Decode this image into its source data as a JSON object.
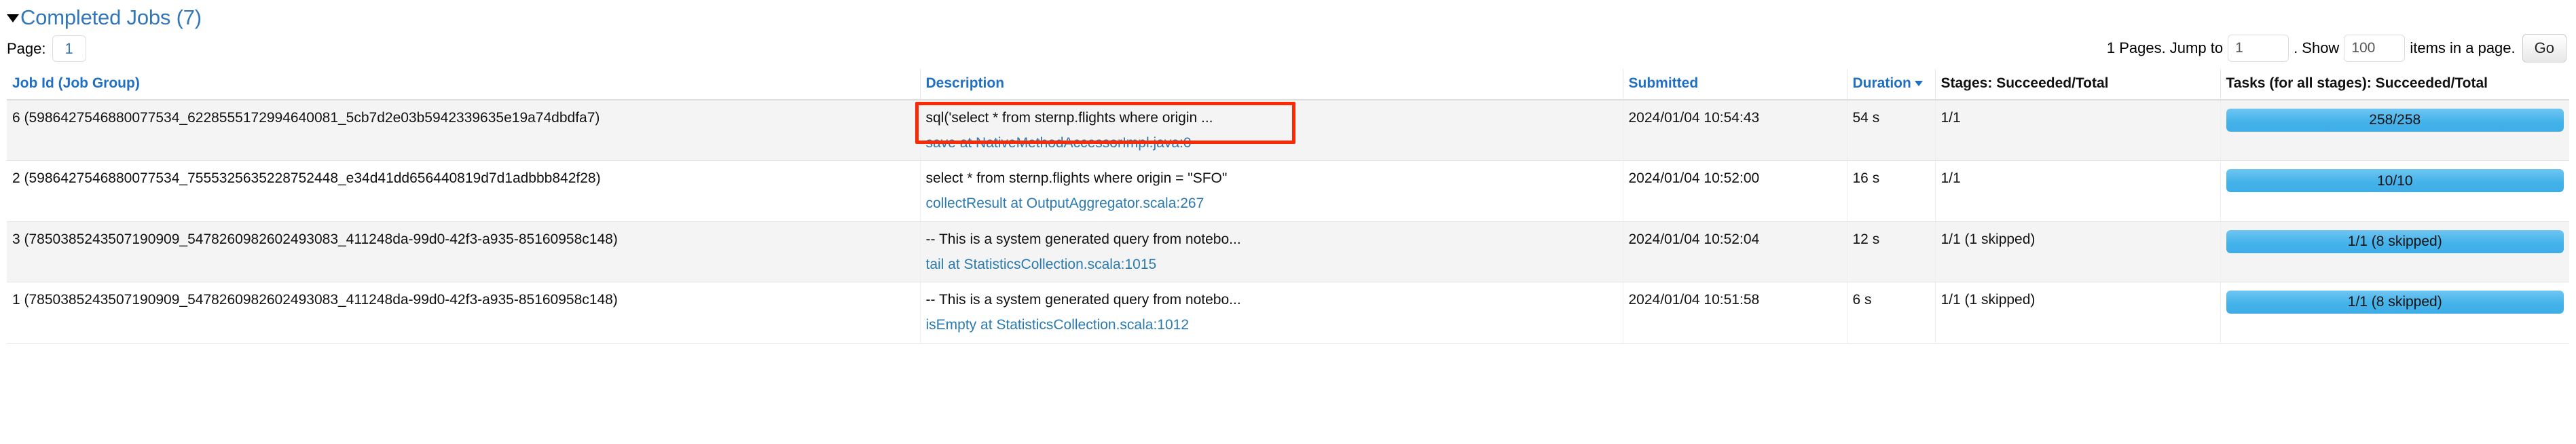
{
  "section": {
    "title": "Completed Jobs (7)",
    "caret_icon": "triangle-down-icon",
    "expanded": true
  },
  "pagination": {
    "page_label": "Page:",
    "current_page": "1",
    "total_pages_text": "1 Pages. Jump to",
    "jump_value": "1",
    "jump_placeholder": "",
    "show_separator": ". Show",
    "show_value": "100",
    "show_placeholder": "",
    "items_suffix": "items in a page.",
    "go_label": "Go"
  },
  "table": {
    "columns": [
      {
        "key": "job_id",
        "label": "Job Id (Job Group)",
        "link": true,
        "sorted": false
      },
      {
        "key": "description",
        "label": "Description",
        "link": true,
        "sorted": false
      },
      {
        "key": "submitted",
        "label": "Submitted",
        "link": true,
        "sorted": false
      },
      {
        "key": "duration",
        "label": "Duration",
        "link": true,
        "sorted": true
      },
      {
        "key": "stages",
        "label": "Stages: Succeeded/Total",
        "link": false,
        "sorted": false
      },
      {
        "key": "tasks",
        "label": "Tasks (for all stages): Succeeded/Total",
        "link": false,
        "sorted": false
      }
    ],
    "rows": [
      {
        "job_id": "6 (5986427546880077534_6228555172994640081_5cb7d2e03b5942339635e19a74dbdfa7)",
        "description_main": "sql('select * from sternp.flights where origin ...",
        "description_link": "save at NativeMethodAccessorImpl.java:0",
        "submitted": "2024/01/04 10:54:43",
        "duration": "54 s",
        "stages": "1/1",
        "tasks_text": "258/258",
        "tasks_percent": 100
      },
      {
        "job_id": "2 (5986427546880077534_7555325635228752448_e34d41dd656440819d7d1adbbb842f28)",
        "description_main": "select * from sternp.flights where origin = \"SFO\"",
        "description_link": "collectResult at OutputAggregator.scala:267",
        "submitted": "2024/01/04 10:52:00",
        "duration": "16 s",
        "stages": "1/1",
        "tasks_text": "10/10",
        "tasks_percent": 100
      },
      {
        "job_id": "3 (7850385243507190909_5478260982602493083_411248da-99d0-42f3-a935-85160958c148)",
        "description_main": "-- This is a system generated query from notebo...",
        "description_link": "tail at StatisticsCollection.scala:1015",
        "submitted": "2024/01/04 10:52:04",
        "duration": "12 s",
        "stages": "1/1 (1 skipped)",
        "tasks_text": "1/1 (8 skipped)",
        "tasks_percent": 100
      },
      {
        "job_id": "1 (7850385243507190909_5478260982602493083_411248da-99d0-42f3-a935-85160958c148)",
        "description_main": "-- This is a system generated query from notebo...",
        "description_link": "isEmpty at StatisticsCollection.scala:1012",
        "submitted": "2024/01/04 10:51:58",
        "duration": "6 s",
        "stages": "1/1 (1 skipped)",
        "tasks_text": "1/1 (8 skipped)",
        "tasks_percent": 100
      }
    ]
  },
  "annotation": {
    "color": "#f92b07",
    "target": "description-cell-row-1"
  },
  "colors": {
    "link": "#3377bb",
    "header_link": "#1f6fc4",
    "progress": "#45b3ea",
    "annotation": "#f92b07"
  }
}
